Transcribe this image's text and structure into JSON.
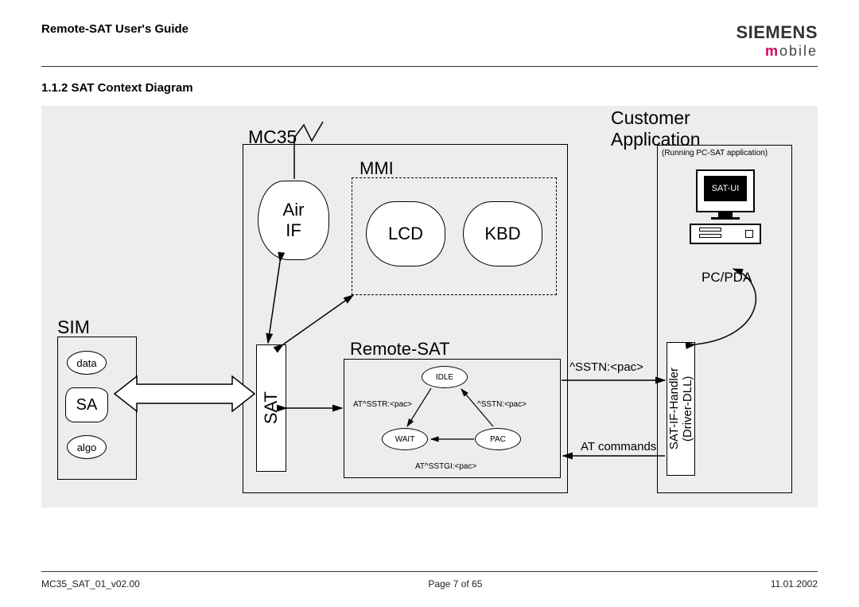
{
  "header": {
    "title": "Remote-SAT User's Guide"
  },
  "brand": {
    "line1": "SIEMENS",
    "line2_bold": "m",
    "line2_rest": "obile"
  },
  "section": {
    "heading": "1.1.2  SAT Context Diagram"
  },
  "diagram": {
    "mc35_label": "MC35",
    "air_if": "Air\nIF",
    "mmi_label": "MMI",
    "lcd": "LCD",
    "kbd": "KBD",
    "sat_vert": "SAT",
    "remote_sat_label": "Remote-SAT",
    "state_idle": "IDLE",
    "state_wait": "WAIT",
    "state_pac": "PAC",
    "edge_at_sstr": "AT^SSTR:<pac>",
    "edge_sstn": "^SSTN:<pac>",
    "edge_at_sstgi": "AT^SSTGI:<pac>",
    "sim_label": "SIM",
    "sim_sa": "SA",
    "sim_data": "data",
    "sim_algo": "algo",
    "customer_title": "Customer\nApplication",
    "customer_sub": "(Running PC-SAT application)",
    "sat_ui": "SAT-UI",
    "pc_pda_label": "PC/PDA",
    "sat_if_handler": "SAT-IF-Handler\n(Driver-DLL)",
    "link_sstn": "^SSTN:<pac>",
    "link_at": "AT commands"
  },
  "footer": {
    "left": "MC35_SAT_01_v02.00",
    "center": "Page 7 of 65",
    "right": "11.01.2002"
  }
}
